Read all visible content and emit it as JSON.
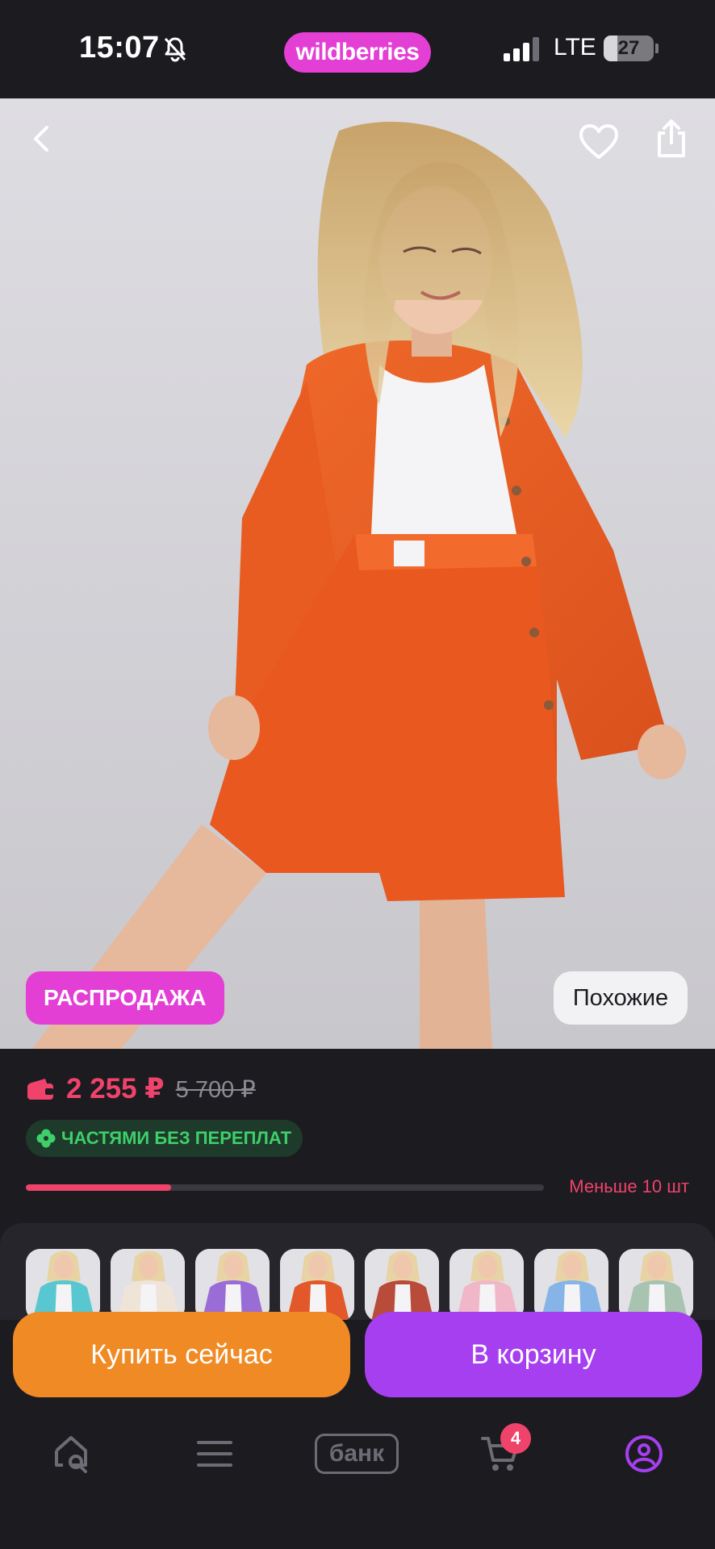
{
  "status_bar": {
    "time": "15:07",
    "brand": "wildberries",
    "network": "LTE",
    "battery": "27",
    "battery_level": 0.27,
    "icons": [
      "bell-slash-icon",
      "signal-icon",
      "battery-icon"
    ]
  },
  "hero": {
    "icons": [
      "back-chevron-icon",
      "heart-icon",
      "share-icon"
    ],
    "sale_badge": "РАСПРОДАЖА",
    "similar_label": "Похожие"
  },
  "price": {
    "current": "2 255 ₽",
    "old": "5 700 ₽",
    "installments": "ЧАСТЯМИ БЕЗ ПЕРЕПЛАТ",
    "stock_text": "Меньше 10 шт",
    "stock_level": 0.28
  },
  "colors": {
    "accent_pink": "#e33fd4",
    "price_red": "#f0436b",
    "buy_orange": "#f08a24",
    "cart_purple": "#a63ff0",
    "installment_green": "#3ecf6a",
    "variants": [
      {
        "shirt": "#58c7cf"
      },
      {
        "shirt": "#efe4d8"
      },
      {
        "shirt": "#9a6cd6"
      },
      {
        "shirt": "#e2582a",
        "selected": true
      },
      {
        "shirt": "#b84b3a"
      },
      {
        "shirt": "#f0b7c8"
      },
      {
        "shirt": "#86b4e6"
      },
      {
        "shirt": "#a9c3b1"
      }
    ]
  },
  "actions": {
    "buy_now": "Купить сейчас",
    "add_to_cart": "В корзину"
  },
  "tabbar": {
    "items": [
      "home-search-icon",
      "menu-icon",
      "bank-icon",
      "cart-icon",
      "profile-icon"
    ],
    "bank_label": "банк",
    "cart_count": "4"
  }
}
